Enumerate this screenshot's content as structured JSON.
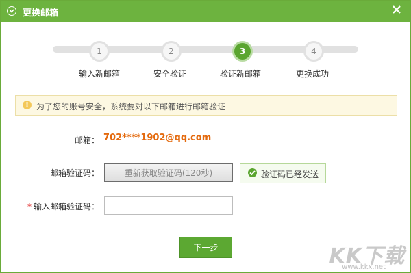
{
  "window": {
    "title": "更换邮箱",
    "header_color": "#6db33f",
    "icons": {
      "title": "chevron-circle-icon",
      "close": "close-icon"
    }
  },
  "steps": [
    {
      "number": "1",
      "label": "输入新邮箱",
      "active": false
    },
    {
      "number": "2",
      "label": "安全验证",
      "active": false
    },
    {
      "number": "3",
      "label": "验证新邮箱",
      "active": true
    },
    {
      "number": "4",
      "label": "更换成功",
      "active": false
    }
  ],
  "notice": {
    "icon": "exclamation-icon",
    "text": "为了您的账号安全，系统要对以下邮箱进行邮箱验证"
  },
  "form": {
    "email_label": "邮箱：",
    "email_value": "702****1902@qq.com",
    "code_label": "邮箱验证码：",
    "resend_button": "重新获取验证码(120秒)",
    "sent_status": "验证码已经发送",
    "sent_icon": "check-circle-icon",
    "required_mark": "*",
    "input_label": "输入邮箱验证码：",
    "input_value": "",
    "next_button": "下一步"
  },
  "watermark": {
    "logo": "KK下载",
    "url": "www.kkx.net"
  },
  "colors": {
    "accent": "#5ca832",
    "email": "#e46a0e",
    "notice_bg": "#fdf8e2"
  }
}
